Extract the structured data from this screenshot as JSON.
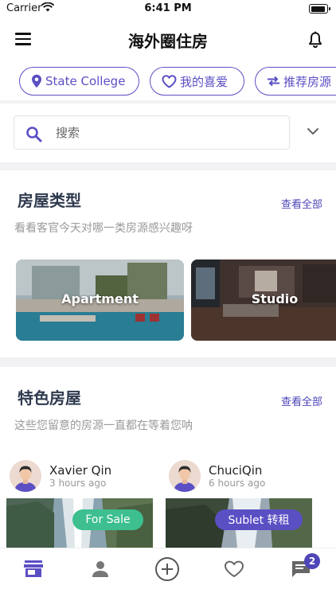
{
  "status_bar": {
    "carrier": "Carrier",
    "time": "6:41 PM"
  },
  "header": {
    "title": "海外圈住房"
  },
  "chips": [
    {
      "label": "State College",
      "icon": "map-pin-icon"
    },
    {
      "label": "我的喜爱",
      "icon": "heart-icon"
    },
    {
      "label": "推荐房源",
      "icon": "swap-arrows-icon"
    }
  ],
  "search": {
    "placeholder": "搜索",
    "value": ""
  },
  "property_types": {
    "title": "房屋类型",
    "view_all": "查看全部",
    "subtitle": "看看客官今天对哪一类房源感兴趣呀",
    "items": [
      {
        "label": "Apartment"
      },
      {
        "label": "Studio"
      }
    ]
  },
  "featured": {
    "title": "特色房屋",
    "view_all": "查看全部",
    "subtitle": "这些您留意的房源一直都在等着您呐",
    "listings": [
      {
        "user": "Xavier Qin",
        "time": "3 hours ago",
        "badge": "For Sale",
        "badge_color": "#3dbf8f"
      },
      {
        "user": "ChuciQin",
        "time": "6 hours ago",
        "badge": "Sublet 转租",
        "badge_color": "#5b4fc4"
      }
    ]
  },
  "tab_bar": {
    "tabs": [
      "store-icon",
      "person-icon",
      "plus-circle-icon",
      "heart-outline-icon",
      "chat-icon"
    ],
    "messages_badge": "2"
  },
  "colors": {
    "accent": "#5b4fc4",
    "green": "#3dbf8f",
    "title": "#2f3a4e"
  }
}
